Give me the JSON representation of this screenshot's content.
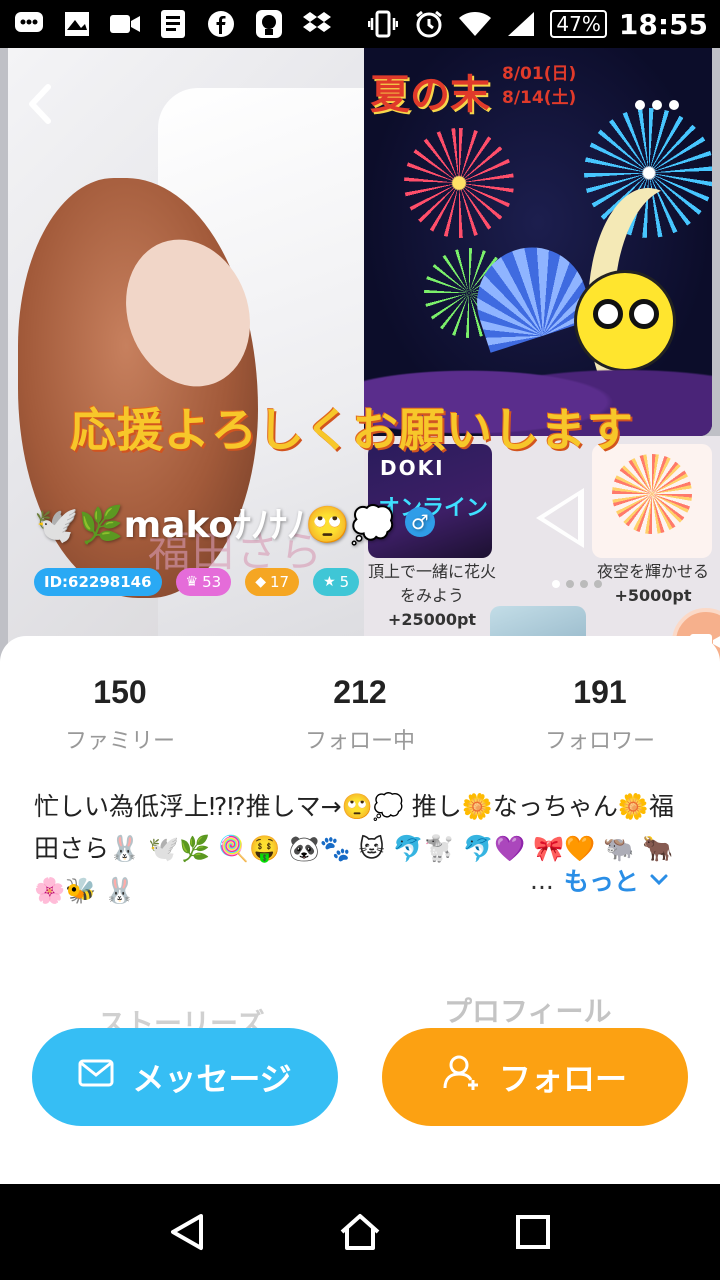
{
  "status_bar": {
    "battery": "47%",
    "time": "18:55",
    "icons": [
      "message-icon",
      "wallpaper-icon",
      "video-icon",
      "news-icon",
      "facebook-icon",
      "app-icon",
      "dropbox-icon",
      "vibrate-icon",
      "alarm-icon",
      "wifi-icon",
      "signal-icon"
    ]
  },
  "header": {
    "back_icon": "chevron-left-icon",
    "more_icon": "more-icon"
  },
  "hero": {
    "poster_title": "夏の末",
    "poster_dates": [
      "8/01(日)",
      "8/14(土)"
    ],
    "watermark_name": "福田さら",
    "banner": "応援よろしくお願いします",
    "doki": "DOKI",
    "doki_sub": "オンライン",
    "gifts": [
      {
        "label": "頂上で一緒に花火をみよう",
        "points": "+25000pt"
      },
      {
        "label": "夜空を輝かせる",
        "points": "+5000pt"
      }
    ]
  },
  "profile": {
    "name": "🕊️🌿makoﾅﾉﾅﾉ🙄💭",
    "gender": "♂",
    "badges": {
      "id": "ID:62298146",
      "crown": "53",
      "gem": "17",
      "star": "5"
    }
  },
  "stats": [
    {
      "value": "150",
      "label": "ファミリー"
    },
    {
      "value": "212",
      "label": "フォロー中"
    },
    {
      "value": "191",
      "label": "フォロワー"
    }
  ],
  "bio": "忙しい為低浮上⁉︎⁉︎推しマ→🙄💭 推し🌼なっちゃん🌼福田さら🐰 🕊️🌿 🍭🤑 🐼🐾 🐱 🐬🐩 🐬💜 🎀🧡 🐃 🐂 🌸🐝 🐰",
  "more": {
    "ellipsis": "...",
    "label": "もっと",
    "chevron": "⌄"
  },
  "tabs": {
    "stories": "ストーリーズ",
    "profile": "プロフィール"
  },
  "buttons": {
    "message": "メッセージ",
    "follow": "フォロー"
  },
  "colors": {
    "message_button": "#36bef4",
    "follow_button": "#fca112",
    "link": "#2a8ee6"
  }
}
